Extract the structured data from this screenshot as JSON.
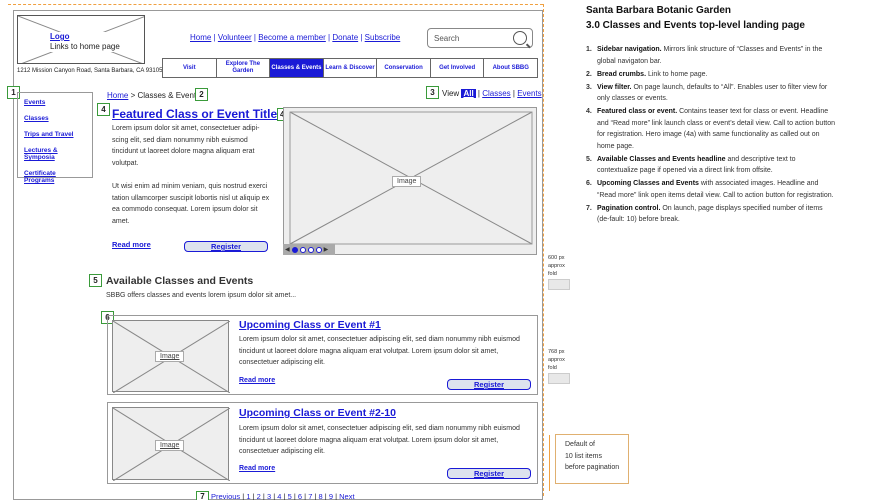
{
  "header": {
    "logo_title": "Logo",
    "logo_sub": "Links to home page",
    "address": "1212 Mission Canyon Road, Santa Barbara, CA 93105",
    "topnav": [
      "Home",
      "Volunteer",
      "Become a member",
      "Donate",
      "Subscribe"
    ],
    "search_placeholder": "Search"
  },
  "mainnav": [
    {
      "label": "Visit",
      "active": false
    },
    {
      "label": "Explore The Garden",
      "active": false
    },
    {
      "label": "Classes & Events",
      "active": true
    },
    {
      "label": "Learn & Discover",
      "active": false
    },
    {
      "label": "Conservation",
      "active": false
    },
    {
      "label": "Get Involved",
      "active": false
    },
    {
      "label": "About SBBG",
      "active": false
    }
  ],
  "callouts": {
    "c1": "1",
    "c2": "2",
    "c3": "3",
    "c4": "4",
    "c4a": "4a",
    "c5": "5",
    "c6": "6",
    "c7": "7"
  },
  "sidebar": [
    "Events",
    "Classes",
    "Trips and Travel",
    "Lectures & Symposia",
    "Certificate Programs"
  ],
  "breadcrumb": {
    "home": "Home",
    "sep": " > ",
    "current": "Classes & Events"
  },
  "view_filter": {
    "label": "View",
    "options": [
      "All",
      "Classes",
      "Events"
    ]
  },
  "featured": {
    "title": "Featured Class or Event Title",
    "p1": "Lorem ipsum dolor sit amet, consectetuer adipi-scing elit, sed diam nonummy nibh euismod tincidunt ut laoreet dolore magna aliquam erat volutpat.",
    "p2": "Ut wisi enim ad minim veniam, quis nostrud exerci tation ullamcorper suscipit lobortis nisl ut aliquip ex ea commodo consequat. Lorem ipsum dolor sit amet.",
    "read_more": "Read more",
    "register": "Register",
    "image_label": "Image"
  },
  "available": {
    "title": "Available Classes and Events",
    "desc": "SBBG offers classes and events lorem ipsum dolor sit amet..."
  },
  "events": [
    {
      "title": "Upcoming Class or Event #1",
      "desc": "Lorem ipsum dolor sit amet, consectetuer adipiscing elit, sed diam nonummy nibh euismod tincidunt ut laoreet dolore magna aliquam erat volutpat. Lorem ipsum dolor sit amet, consectetuer adipiscing elit.",
      "read_more": "Read more",
      "register": "Register",
      "image_label": "Image"
    },
    {
      "title": "Upcoming Class or Event #2-10",
      "desc": "Lorem ipsum dolor sit amet, consectetuer adipiscing elit, sed diam nonummy nibh euismod tincidunt ut laoreet dolore magna aliquam erat volutpat. Lorem ipsum dolor sit amet, consectetuer adipiscing elit.",
      "read_more": "Read more",
      "register": "Register",
      "image_label": "Image"
    }
  ],
  "pagination": {
    "previous": "Previous",
    "pages": [
      "1",
      "2",
      "3",
      "4",
      "5",
      "6",
      "7",
      "8",
      "9"
    ],
    "next": "Next"
  },
  "annotations": {
    "fold600": [
      "600 px",
      "approx",
      "fold"
    ],
    "fold768": [
      "768 px",
      "approx",
      "fold"
    ],
    "default_box": [
      "Default of",
      "10 list items",
      "before pagination"
    ]
  },
  "spec": {
    "title": "Santa Barbara Botanic Garden",
    "subtitle": "3.0 Classes and Events top-level landing page",
    "notes": [
      {
        "n": "1.",
        "head": "Sidebar navigation.",
        "text": " Mirrors link structure of “Classes and Events” in the global navigaton bar."
      },
      {
        "n": "2.",
        "head": "Bread crumbs.",
        "text": " Link to home page."
      },
      {
        "n": "3.",
        "head": "View filter.",
        "text": " On page launch, defaults to “All”. Enables user to filter view for only classes or events."
      },
      {
        "n": "4.",
        "head": "Featured class or event.",
        "text": " Contains teaser text for class or event. Headline and “Read more” link launch class or event’s detail view. Call to action button for registration. Hero image (4a) with same functionality as called out on home page."
      },
      {
        "n": "5.",
        "head": "Available Classes and Events headline",
        "text": " and descriptive text to contextualize page if opened via a direct link from offsite."
      },
      {
        "n": "6.",
        "head": "Upcoming Classes and Events",
        "text": " with associated images. Headline and “Read more” link open items detail view. Call to action button for registration."
      },
      {
        "n": "7.",
        "head": "Pagination control.",
        "text": " On launch, page displays specified number of items (de-fault: 10) before break."
      }
    ]
  }
}
